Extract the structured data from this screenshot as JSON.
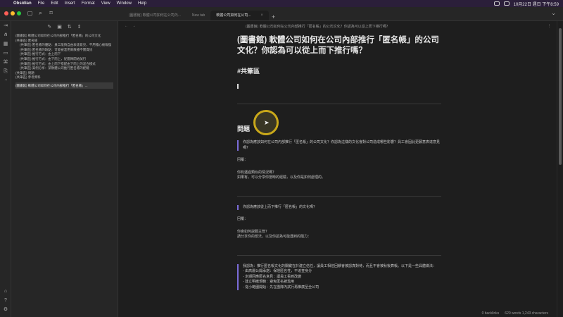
{
  "menubar": {
    "app_name": "Obsidian",
    "items": [
      "File",
      "Edit",
      "Insert",
      "Format",
      "View",
      "Window",
      "Help"
    ],
    "clock": "10月22日 週日 下午8:59"
  },
  "tabs": [
    {
      "label": "(圖書館) 軟體公司如何在公司內..."
    },
    {
      "label": "New tab"
    },
    {
      "label": "軟體公司如何在公司..."
    }
  ],
  "editor": {
    "breadcrumb": "(圖書館) 軟體公司如何在公司內部推行「匿名帳」的公司文化？你認為可以從上而下推行嗎？",
    "title": "(圖書館) 軟體公司如何在公司內部推行「匿名帳」的公司文化？你認為可以從上而下推行嗎？",
    "h2": "#共筆區",
    "h3": "問題",
    "q1": "你認為應該如何在公司內部推行「匿名帳」的公司文化？你認為這樣的文化會對公司造成哪些影響？員工會因此更願意表達意見嗎？",
    "a1_label": "回覆：",
    "a1_q": "你有遇過類似的情況嗎？",
    "a1_text": "如果有，可以分享你當時的經驗，以及你是如何處理的。",
    "q2": "你認為應該從上而下推行「匿名帳」的文化嗎？",
    "a2_label": "回覆：",
    "a2_q": "你會如何說服主管？",
    "a2_text": "請分享你的想法，以及你認為可能遇到的阻力：",
    "q3": "我認為：推行匿名帳文化的關鍵在於建立信任，讓員工相信回饋會被認真對待，而且不會被秋後算帳。以下是一些具體做法：",
    "q3_items": [
      "由高層公開承諾：保證匿名性，不追查身分",
      "定期回應匿名意見：讓員工看到改變",
      "建立明確規範：避免匿名被濫用",
      "從小範圍開始：先在團隊內試行再推廣至全公司"
    ],
    "status_links": "0 backlinks",
    "status_words": "620 words 1,243 characters"
  },
  "sidebar": {
    "tree": [
      {
        "label": "(圖書館) 軟體公司如何在公司內部推行「匿名帳」的公司文化",
        "level": 0
      },
      {
        "label": "(共筆區) 匿名帳",
        "level": 0
      },
      {
        "label": "(共筆區) 匿名帳的優點：員工能夠自由表達意見，不用擔心被報復",
        "level": 1
      },
      {
        "label": "(共筆區) 匿名帳的缺點：可能被濫用來散播不實資訊",
        "level": 1
      },
      {
        "label": "(共筆區) 推行方式：由上而下",
        "level": 1
      },
      {
        "label": "(共筆區) 推行方式：由下而上，從團隊開始試行",
        "level": 1
      },
      {
        "label": "(共筆區) 推行方式：由上而下搭配由下而上的混合模式",
        "level": 1
      },
      {
        "label": "(共筆區) 案例分享：某軟體公司推行匿名帳的經驗",
        "level": 1
      },
      {
        "label": "(共筆區) 問題",
        "level": 0
      },
      {
        "label": "(共筆區) 參考資料",
        "level": 0
      },
      {
        "label": "(圖書館) 軟體公司如何在公司內部推行「匿名帳」...",
        "level": 0,
        "selected": true
      }
    ]
  },
  "colors": {
    "accent": "#7b6cd9",
    "ring": "#c9a81a"
  }
}
